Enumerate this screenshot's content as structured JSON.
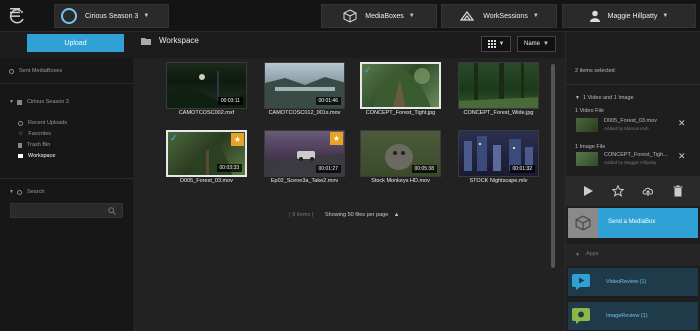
{
  "header": {
    "project": "Cirious Season 3",
    "mediaboxes": "MediaBoxes",
    "worksessions": "WorkSessions",
    "user": "Maggie Hillpatty"
  },
  "toolbar": {
    "upload": "Upload",
    "folder": "Workspace",
    "sort": "Name"
  },
  "sidebar": {
    "sent_mediaboxes": "Sent MediaBoxes",
    "project": "Cirious Season 3",
    "items": [
      {
        "label": "Recent Uploads"
      },
      {
        "label": "Favorites"
      },
      {
        "label": "Trash Bin"
      },
      {
        "label": "Workspace"
      }
    ],
    "search": "Search"
  },
  "files": [
    {
      "name": "CAMOTCOSC002.mxf",
      "duration": "00:03:11",
      "selected": false,
      "starred": false
    },
    {
      "name": "CAMOTCOSC012_001s.mov",
      "duration": "00:01:46",
      "selected": false,
      "starred": false
    },
    {
      "name": "CONCEPT_Forest_Tight.jpg",
      "duration": "",
      "selected": true,
      "starred": false
    },
    {
      "name": "CONCEPT_Forest_Wide.jpg",
      "duration": "",
      "selected": false,
      "starred": false
    },
    {
      "name": "D005_Forest_03.mov",
      "duration": "00:03:33",
      "selected": true,
      "starred": true
    },
    {
      "name": "Ep02_Scene3a_Take2.mov",
      "duration": "00:01:27",
      "selected": false,
      "starred": true
    },
    {
      "name": "Stock Monkeys HD.mov",
      "duration": "00:05:38",
      "selected": false,
      "starred": false
    },
    {
      "name": "STOCK Nightscape.mlv",
      "duration": "00:01:32",
      "selected": false,
      "starred": false
    }
  ],
  "pager": {
    "count": "( 8 items )",
    "per_page": "Showing 50 files per page"
  },
  "selection": {
    "summary": "2 items selected",
    "group": "1 Video and 1 Image",
    "video_header": "1 Video File",
    "video_name": "D005_Forest_03.mov",
    "video_by": "Added by Marcus Huh",
    "image_header": "1 Image File",
    "image_name": "CONCEPT_Forest_Tigh...",
    "image_by": "Added by Maggie Hillpatty"
  },
  "send_mediabox": "Send a MediaBox",
  "apps": {
    "header": "Apps",
    "items": [
      {
        "label": "VideoReview (1)"
      },
      {
        "label": "ImageReview (1)"
      }
    ]
  },
  "colors": {
    "accent": "#2fa1d6",
    "star": "#e8a224",
    "app_tile": "#1f3b4a"
  }
}
